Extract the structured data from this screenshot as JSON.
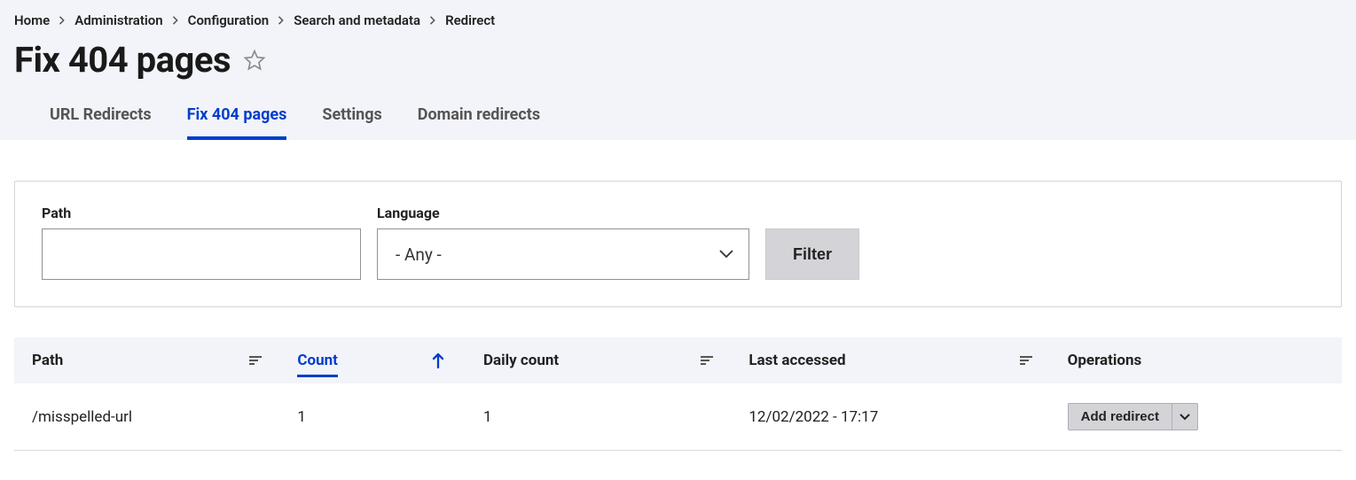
{
  "breadcrumb": [
    {
      "label": "Home"
    },
    {
      "label": "Administration"
    },
    {
      "label": "Configuration"
    },
    {
      "label": "Search and metadata"
    },
    {
      "label": "Redirect"
    }
  ],
  "page_title": "Fix 404 pages",
  "tabs": [
    {
      "label": "URL Redirects",
      "active": false
    },
    {
      "label": "Fix 404 pages",
      "active": true
    },
    {
      "label": "Settings",
      "active": false
    },
    {
      "label": "Domain redirects",
      "active": false
    }
  ],
  "filters": {
    "path_label": "Path",
    "path_value": "",
    "language_label": "Language",
    "language_selected": "- Any -",
    "filter_button": "Filter"
  },
  "table": {
    "columns": [
      {
        "label": "Path",
        "indicator": true
      },
      {
        "label": "Count",
        "sorted_asc": true
      },
      {
        "label": "Daily count",
        "indicator": true
      },
      {
        "label": "Last accessed",
        "indicator": true
      },
      {
        "label": "Operations"
      }
    ],
    "rows": [
      {
        "path": "/misspelled-url",
        "count": "1",
        "daily_count": "1",
        "last_accessed": "12/02/2022 - 17:17",
        "operation": "Add redirect"
      }
    ]
  }
}
